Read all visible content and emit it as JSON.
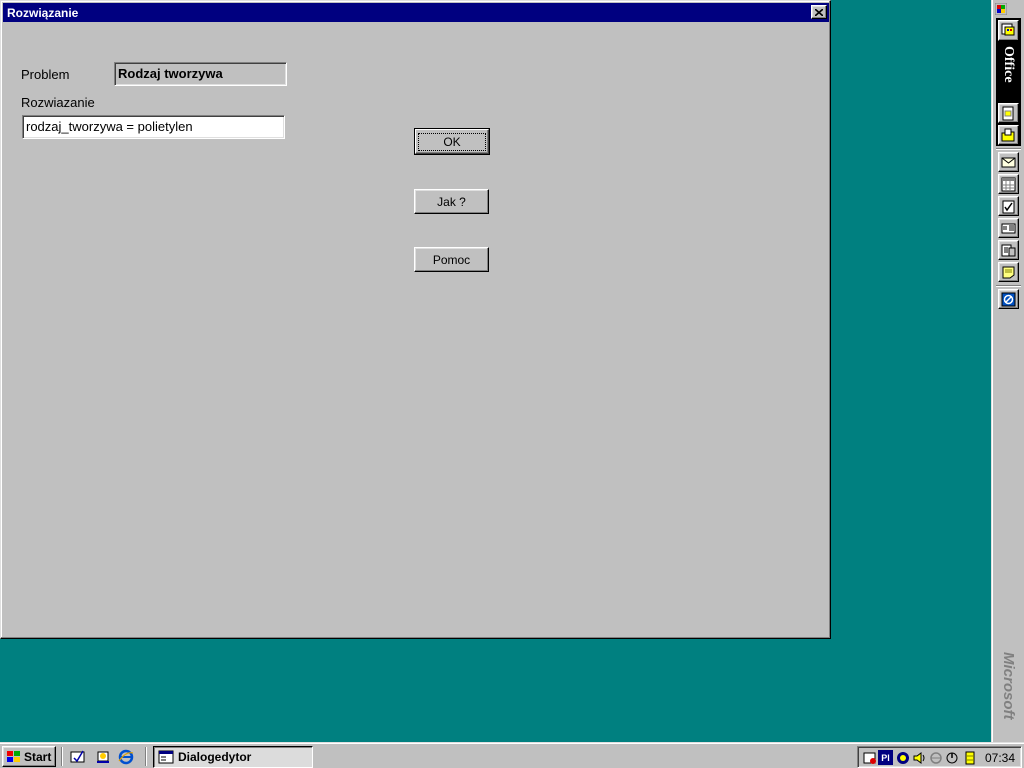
{
  "dialog": {
    "title": "Rozwiązanie",
    "problem_label": "Problem",
    "problem_value": "Rodzaj tworzywa",
    "solution_label": "Rozwiazanie",
    "solution_value": "rodzaj_tworzywa =  polietylen",
    "ok_label": "OK",
    "how_label": "Jak ?",
    "help_label": "Pomoc"
  },
  "office_bar": {
    "title": "Office",
    "brand": "Microsoft",
    "buttons": [
      "new-office-document-icon",
      "open-office-document-icon",
      "new-message-icon",
      "new-appointment-icon",
      "new-task-icon",
      "new-contact-icon",
      "new-journal-entry-icon",
      "new-note-icon",
      "getting-results-icon"
    ]
  },
  "taskbar": {
    "start_label": "Start",
    "task_label": "Dialogedytor",
    "clock": "07:34",
    "lang_indicator": "Pl"
  },
  "colors": {
    "desktop": "#008080",
    "titlebar": "#000080",
    "face": "#c0c0c0"
  }
}
